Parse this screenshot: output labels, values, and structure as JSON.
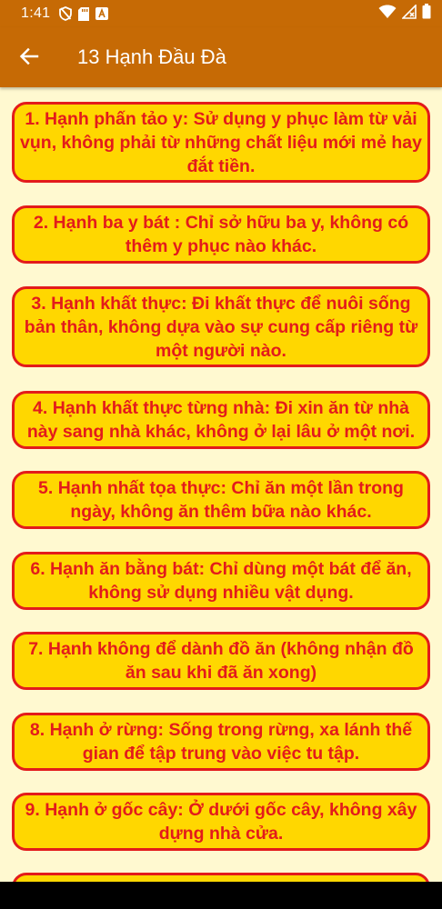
{
  "status_bar": {
    "time": "1:41",
    "icons": [
      "shield-icon",
      "sd-card-icon",
      "translate-icon",
      "wifi-icon",
      "signal-icon",
      "battery-icon"
    ]
  },
  "app_bar": {
    "back_icon": "arrow-left-icon",
    "title": "13 Hạnh Đầu Đà"
  },
  "colors": {
    "app_bar": "#c66a05",
    "background": "#fff9d0",
    "card_fill": "#ffd700",
    "card_border_text": "#e31b1b"
  },
  "items": [
    "1. Hạnh phấn tảo y: Sử dụng y phục làm từ vải vụn, không phải từ những chất liệu mới mẻ hay đắt tiền.",
    "2. Hạnh ba y bát : Chỉ sở hữu ba y, không có thêm y phục nào khác.",
    "3. Hạnh khất thực: Đi khất thực để nuôi sống bản thân, không dựa vào sự cung cấp riêng từ một người nào.",
    "4. Hạnh khất thực từng nhà: Đi xin ăn từ nhà này sang nhà khác, không ở lại lâu ở một nơi.",
    "5. Hạnh nhất tọa thực: Chỉ ăn một lần trong ngày, không ăn thêm bữa nào khác.",
    "6. Hạnh ăn bằng bát: Chỉ dùng một bát để ăn, không sử dụng nhiều vật dụng.",
    "7. Hạnh không để dành đồ ăn (không nhận đồ ăn sau khi đã ăn xong)",
    "8. Hạnh ở rừng: Sống trong rừng, xa lánh thế gian để tập trung vào việc tu tập.",
    "9. Hạnh ở gốc cây: Ở dưới gốc cây, không xây dựng nhà cửa."
  ]
}
